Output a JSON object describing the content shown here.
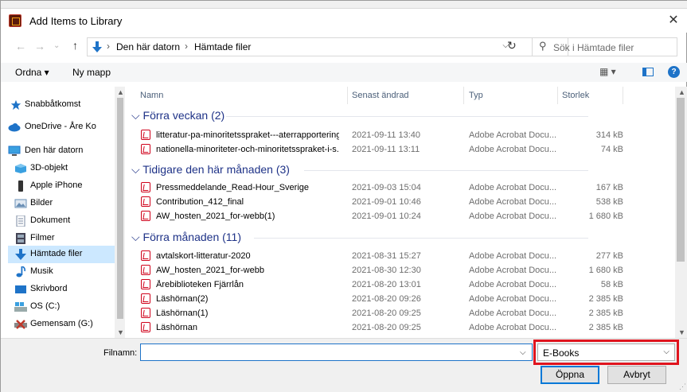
{
  "window": {
    "title": "Add Items to Library",
    "close": "✕"
  },
  "address": {
    "crumbs": [
      "Den här datorn",
      "Hämtade filer"
    ],
    "separators": [
      "›",
      "›",
      "›"
    ],
    "back": "←",
    "forward": "→",
    "up": "↑",
    "history": "⌄",
    "dropdown": "⌵",
    "refresh": "↻"
  },
  "search": {
    "placeholder": "Sök i Hämtade filer",
    "icon": "⚲"
  },
  "toolbar": {
    "organize": "Ordna ▾",
    "new_folder": "Ny mapp",
    "view": "▦ ▾",
    "help": "?"
  },
  "nav": {
    "items": [
      {
        "label": "Snabbåtkomst",
        "icon": "star-icon",
        "color": "#1e73c8"
      },
      {
        "label": "OneDrive - Åre Ko",
        "icon": "cloud-icon",
        "color": "#1e73c8"
      },
      {
        "label": "Den här datorn",
        "icon": "computer-icon",
        "color": "#1e73c8"
      },
      {
        "label": "3D-objekt",
        "icon": "cube-icon",
        "color": "#3aa0e0"
      },
      {
        "label": "Apple iPhone",
        "icon": "phone-icon",
        "color": "#333333"
      },
      {
        "label": "Bilder",
        "icon": "pictures-icon",
        "color": "#6a8fb5"
      },
      {
        "label": "Dokument",
        "icon": "document-icon",
        "color": "#7a8aa0"
      },
      {
        "label": "Filmer",
        "icon": "film-icon",
        "color": "#445"
      },
      {
        "label": "Hämtade filer",
        "icon": "download-icon",
        "color": "#1e73c8",
        "selected": true
      },
      {
        "label": "Musik",
        "icon": "music-icon",
        "color": "#1e73c8"
      },
      {
        "label": "Skrivbord",
        "icon": "desktop-icon",
        "color": "#1e73c8"
      },
      {
        "label": "OS (C:)",
        "icon": "drive-icon",
        "color": "#3aa0e0"
      },
      {
        "label": "Gemensam (G:)",
        "icon": "network-drive-icon",
        "color": "#c0392b"
      }
    ]
  },
  "columns": {
    "name": "Namn",
    "modified": "Senast ändrad",
    "type": "Typ",
    "size": "Storlek"
  },
  "groups": [
    {
      "title": "Förra veckan (2)",
      "files": [
        {
          "name": "litteratur-pa-minoritetsspraket---aterrapportering",
          "date": "2021-09-11 13:40",
          "type": "Adobe Acrobat Docu...",
          "size": "314 kB"
        },
        {
          "name": "nationella-minoriteter-och-minoritetsspraket-i-s...",
          "date": "2021-09-11 13:11",
          "type": "Adobe Acrobat Docu...",
          "size": "74 kB"
        }
      ]
    },
    {
      "title": "Tidigare den här månaden (3)",
      "files": [
        {
          "name": "Pressmeddelande_Read-Hour_Sverige",
          "date": "2021-09-03 15:04",
          "type": "Adobe Acrobat Docu...",
          "size": "167 kB"
        },
        {
          "name": "Contribution_412_final",
          "date": "2021-09-01 10:46",
          "type": "Adobe Acrobat Docu...",
          "size": "538 kB"
        },
        {
          "name": "AW_hosten_2021_for-webb(1)",
          "date": "2021-09-01 10:24",
          "type": "Adobe Acrobat Docu...",
          "size": "1 680 kB"
        }
      ]
    },
    {
      "title": "Förra månaden (11)",
      "files": [
        {
          "name": "avtalskort-litteratur-2020",
          "date": "2021-08-31 15:27",
          "type": "Adobe Acrobat Docu...",
          "size": "277 kB"
        },
        {
          "name": "AW_hosten_2021_for-webb",
          "date": "2021-08-30 12:30",
          "type": "Adobe Acrobat Docu...",
          "size": "1 680 kB"
        },
        {
          "name": "Årebiblioteken Fjärrlån",
          "date": "2021-08-20 13:01",
          "type": "Adobe Acrobat Docu...",
          "size": "58 kB"
        },
        {
          "name": "Läshörnan(2)",
          "date": "2021-08-20 09:26",
          "type": "Adobe Acrobat Docu...",
          "size": "2 385 kB"
        },
        {
          "name": "Läshörnan(1)",
          "date": "2021-08-20 09:25",
          "type": "Adobe Acrobat Docu...",
          "size": "2 385 kB"
        },
        {
          "name": "Läshörnan",
          "date": "2021-08-20 09:25",
          "type": "Adobe Acrobat Docu...",
          "size": "2 385 kB"
        }
      ]
    }
  ],
  "bottom": {
    "filename_label": "Filnamn:",
    "filename_value": "",
    "filename_dd": "⌵",
    "filter_value": "E-Books",
    "filter_dd": "⌵",
    "open": "Öppna",
    "cancel": "Avbryt"
  },
  "colors": {
    "highlight_border": "#e0141e",
    "accent": "#1e73c8",
    "group_header": "#1e3287"
  }
}
